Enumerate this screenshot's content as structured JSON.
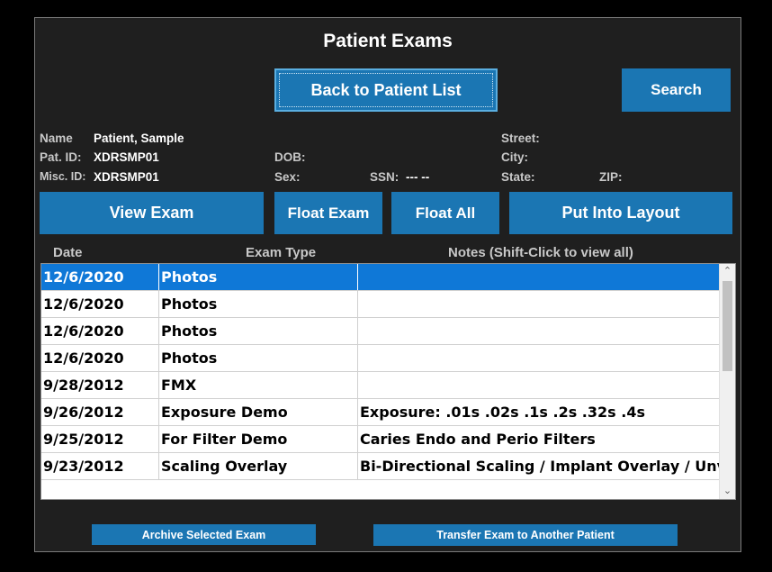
{
  "window": {
    "title": "Patient Exams"
  },
  "buttons": {
    "back": "Back to Patient List",
    "search": "Search",
    "view_exam": "View Exam",
    "float_exam": "Float Exam",
    "float_all": "Float All",
    "put_into_layout": "Put Into Layout",
    "archive": "Archive Selected Exam",
    "transfer": "Transfer Exam to Another Patient"
  },
  "patient": {
    "name_label": "Name",
    "name": "Patient, Sample",
    "pat_id_label": "Pat. ID:",
    "pat_id": "XDRSMP01",
    "misc_id_label": "Misc. ID:",
    "misc_id": "XDRSMP01",
    "dob_label": "DOB:",
    "sex_label": "Sex:",
    "ssn_label": "SSN:",
    "ssn": "--- --",
    "street_label": "Street:",
    "city_label": "City:",
    "state_label": "State:",
    "zip_label": "ZIP:"
  },
  "table": {
    "headers": [
      "Date",
      "Exam Type",
      "Notes (Shift-Click to view all)"
    ],
    "selected_index": 0,
    "rows": [
      {
        "date": "12/6/2020",
        "type": "Photos",
        "notes": ""
      },
      {
        "date": "12/6/2020",
        "type": "Photos",
        "notes": ""
      },
      {
        "date": "12/6/2020",
        "type": "Photos",
        "notes": ""
      },
      {
        "date": "12/6/2020",
        "type": "Photos",
        "notes": ""
      },
      {
        "date": "9/28/2012",
        "type": "FMX",
        "notes": ""
      },
      {
        "date": "9/26/2012",
        "type": "Exposure Demo",
        "notes": "Exposure: .01s .02s .1s .2s .32s .4s"
      },
      {
        "date": "9/25/2012",
        "type": "For Filter Demo",
        "notes": "Caries Endo and Perio Filters"
      },
      {
        "date": "9/23/2012",
        "type": "Scaling Overlay",
        "notes": "Bi-Directional Scaling / Implant Overlay / Unv"
      }
    ]
  },
  "icons": {
    "scroll_up": "chevron-up-icon",
    "scroll_down": "chevron-down-icon"
  },
  "colors": {
    "accent": "#1b76b3",
    "selection": "#0f78d7",
    "background": "#1f1f1f"
  }
}
